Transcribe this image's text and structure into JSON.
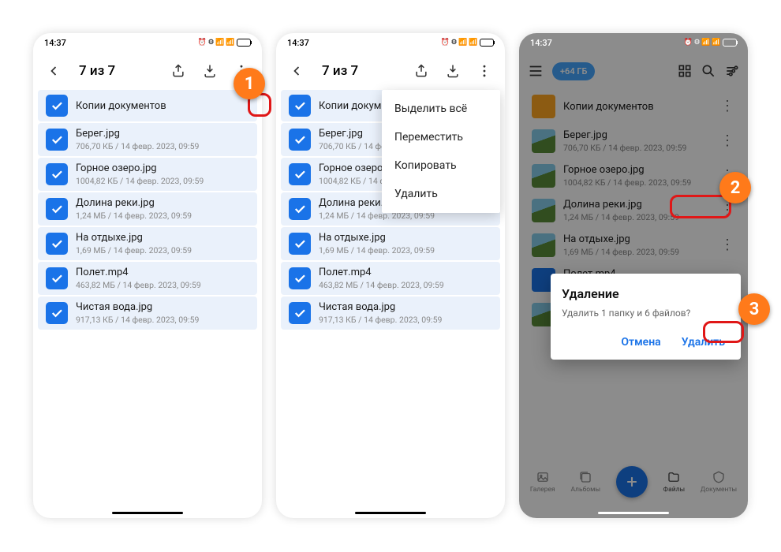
{
  "status": {
    "time": "14:37"
  },
  "selection_title": "7 из 7",
  "files": [
    {
      "name": "Копии документов",
      "meta": "",
      "type": "folder"
    },
    {
      "name": "Берег.jpg",
      "meta": "706,70 КБ / 14 февр. 2023, 09:59",
      "type": "img"
    },
    {
      "name": "Горное озеро.jpg",
      "meta": "1004,82 КБ / 14 февр. 2023, 09:59",
      "type": "img"
    },
    {
      "name": "Долина реки.jpg",
      "meta": "1,24 МБ / 14 февр. 2023, 09:59",
      "type": "img"
    },
    {
      "name": "На отдыхе.jpg",
      "meta": "1,69 МБ / 14 февр. 2023, 09:59",
      "type": "img"
    },
    {
      "name": "Полет.mp4",
      "meta": "463,82 МБ / 14 февр. 2023, 09:59",
      "type": "vid"
    },
    {
      "name": "Чистая вода.jpg",
      "meta": "917,13 КБ / 14 февр. 2023, 09:59",
      "type": "img"
    }
  ],
  "menu": {
    "select_all": "Выделить всё",
    "move": "Переместить",
    "copy": "Копировать",
    "delete": "Удалить"
  },
  "promo": "+64 ГБ",
  "dialog": {
    "title": "Удаление",
    "message": "Удалить 1 папку и 6 файлов?",
    "cancel": "Отмена",
    "confirm": "Удалить"
  },
  "bottomnav": {
    "gallery": "Галерея",
    "albums": "Альбомы",
    "files": "Файлы",
    "documents": "Документы"
  },
  "callouts": {
    "c1": "1",
    "c2": "2",
    "c3": "3"
  }
}
